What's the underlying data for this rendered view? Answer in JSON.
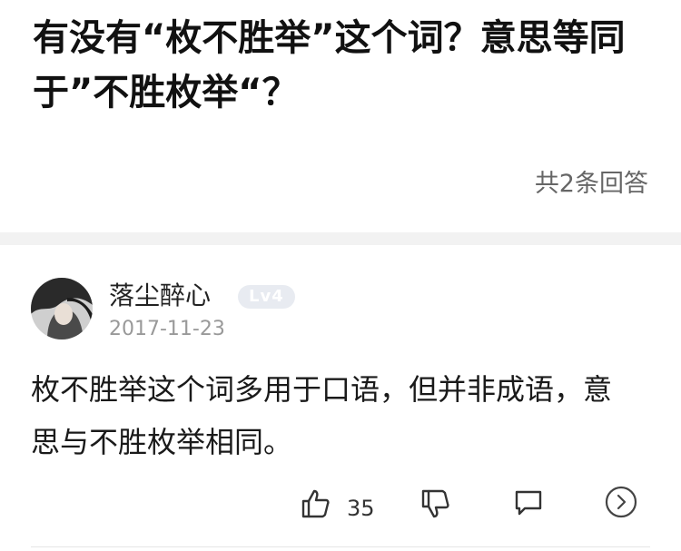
{
  "question": {
    "title": "有没有“枚不胜举”这个词？意思等同于”不胜枚举“？",
    "answer_count": "共2条回答"
  },
  "answer": {
    "author": "落尘醉心",
    "level": "Lv4",
    "date": "2017-11-23",
    "text": "枚不胜举这个词多用于口语，但并非成语，意思与不胜枚举相同。",
    "like_count": "35"
  },
  "icons": {
    "like": "thumbs-up-icon",
    "dislike": "thumbs-down-icon",
    "comment": "comment-bubble-icon",
    "more": "chevron-right-circle-icon"
  },
  "colors": {
    "level_badge_bg": "#e8ebf1",
    "muted_text": "#999999",
    "separator": "#f2f2f2"
  }
}
